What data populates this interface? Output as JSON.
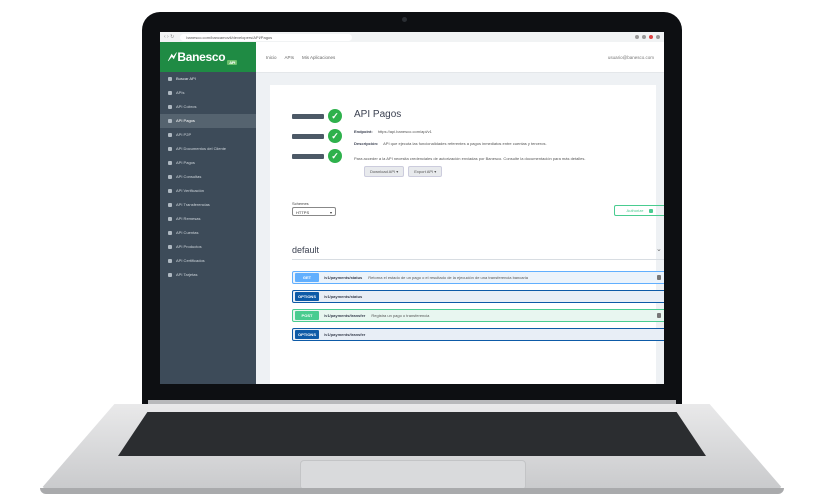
{
  "browser": {
    "url": "banesco.com/bancamovil/developers/API/Pagos",
    "nav_icons": "‹ › ↻"
  },
  "sidebar": {
    "logo": "Banesco",
    "logo_chip": "API",
    "search_label": "Buscar API",
    "items": [
      {
        "label": "APIs"
      },
      {
        "label": "API Cobros"
      },
      {
        "label": "API Pagos"
      },
      {
        "label": "API P2P"
      },
      {
        "label": "API Documentos del Cliente"
      },
      {
        "label": "API Pagos"
      },
      {
        "label": "API Consultas"
      },
      {
        "label": "API Verificación"
      },
      {
        "label": "API Transferencias"
      },
      {
        "label": "API Remesas"
      },
      {
        "label": "API Cuentas"
      },
      {
        "label": "API Productos"
      },
      {
        "label": "API Certificados"
      },
      {
        "label": "API Tarjetas"
      }
    ]
  },
  "topnav": {
    "links": [
      "Inicio",
      "APIs",
      "Mis Aplicaciones"
    ],
    "user": "usuario@banesco.com"
  },
  "api": {
    "title": "API Pagos",
    "endpoint_label": "Endpoint:",
    "endpoint_value": "https://api.banesco.com/api/v1",
    "description_label": "Descripción:",
    "description_value": "API que ejecuta las funcionalidades referentes a pagos inmediatos entre cuentas y terceros.",
    "note": "Para acceder a la API necesita credenciales de autorización enviadas por Banesco. Consulte la documentación para más detalles.",
    "buttons": [
      "Download API ▾",
      "Export API ▾"
    ]
  },
  "schemes": {
    "label": "Schemes",
    "selected": "HTTPS"
  },
  "authorize": {
    "label": "Authorize"
  },
  "tag": {
    "title": "default",
    "chevron": "⌄"
  },
  "operations": [
    {
      "method": "GET",
      "path": "/v1/payments/status",
      "summary": "Retorna el estado de un pago o el resultado de la ejecución de una transferencia bancaria",
      "locked": true,
      "kind": "get"
    },
    {
      "method": "OPTIONS",
      "path": "/v1/payments/status",
      "summary": "",
      "locked": false,
      "kind": "options"
    },
    {
      "method": "POST",
      "path": "/v1/payments/transfer",
      "summary": "Registra un pago o transferencia",
      "locked": true,
      "kind": "post"
    },
    {
      "method": "OPTIONS",
      "path": "/v1/payments/transfer",
      "summary": "",
      "locked": false,
      "kind": "options"
    }
  ],
  "colors": {
    "brand": "#1f8b44",
    "sidebar": "#3d4b59",
    "get": "#61affe",
    "post": "#49cc90",
    "options": "#0d5aa7",
    "ok": "#2eb14c"
  },
  "icons": {
    "status": "check-circle-icon",
    "lock": "lock-icon",
    "search": "search-icon"
  }
}
